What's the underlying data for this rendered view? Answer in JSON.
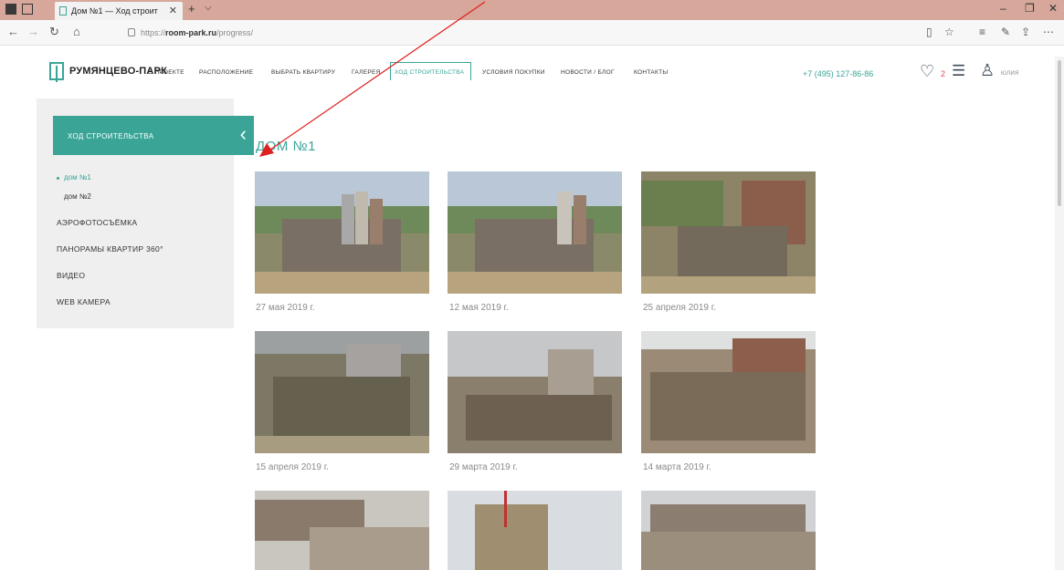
{
  "browser": {
    "tab_title": "Дом №1 — Ход строит",
    "tab_close": "✕",
    "new_tab": "+",
    "tab_dropdown": "⌵",
    "url_prefix": "https://",
    "url_host": "room-park.ru",
    "url_path": "/progress/",
    "minimize": "–",
    "restore": "❐",
    "close": "✕"
  },
  "header": {
    "logo_text": "РУМЯНЦЕВО-ПАРК",
    "nav": [
      "О ПРОЕКТЕ",
      "РАСПОЛОЖЕНИЕ",
      "ВЫБРАТЬ КВАРТИРУ",
      "ГАЛЕРЕЯ",
      "ХОД СТРОИТЕЛЬСТВА",
      "УСЛОВИЯ ПОКУПКИ",
      "НОВОСТИ / БЛОГ",
      "КОНТАКТЫ"
    ],
    "phone": "+7 (495) 127-86-86",
    "favorites_count": "2",
    "user_name": "ЮЛИЯ"
  },
  "sidebar": {
    "heading": "ХОД СТРОИТЕЛЬСТВА",
    "sub_items": [
      "дом №1",
      "дом №2"
    ],
    "items": [
      "АЭРОФОТОСЪЁМКА",
      "ПАНОРАМЫ КВАРТИР 360°",
      "ВИДЕО",
      "WEB КАМЕРА"
    ]
  },
  "main": {
    "title": "ДОМ №1",
    "photos": [
      {
        "date": "27 мая 2019 г."
      },
      {
        "date": "12 мая 2019 г."
      },
      {
        "date": "25 апреля 2019 г."
      },
      {
        "date": "15 апреля 2019 г."
      },
      {
        "date": "29 марта 2019 г."
      },
      {
        "date": "14 марта 2019 г."
      },
      {
        "date": ""
      },
      {
        "date": ""
      },
      {
        "date": ""
      }
    ]
  },
  "colors": {
    "accent": "#3aa597",
    "annotation_arrow": "#e02020"
  }
}
